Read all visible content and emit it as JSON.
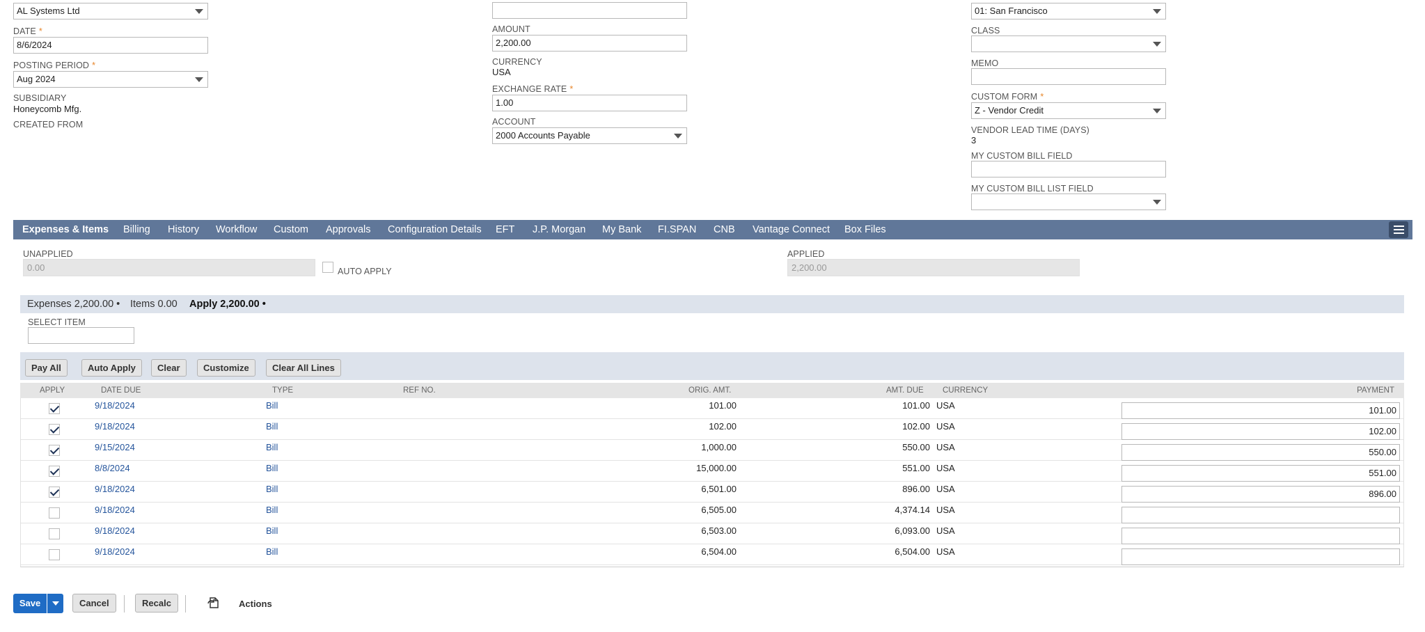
{
  "colors": {
    "tabbar": "#607799",
    "accent": "#1f6cc5",
    "link": "#25559c",
    "required": "#e8862a"
  },
  "left": {
    "vendor_value": "AL Systems Ltd",
    "date_label": "DATE",
    "date_value": "8/6/2024",
    "posting_period_label": "POSTING PERIOD",
    "posting_period_value": "Aug 2024",
    "subsidiary_label": "SUBSIDIARY",
    "subsidiary_value": "Honeycomb Mfg.",
    "created_from_label": "CREATED FROM",
    "required_mark": "*"
  },
  "middle": {
    "top_field_value": "",
    "amount_label": "AMOUNT",
    "amount_value": "2,200.00",
    "currency_label": "CURRENCY",
    "currency_value": "USA",
    "exchange_rate_label": "EXCHANGE RATE",
    "exchange_rate_value": "1.00",
    "account_label": "ACCOUNT",
    "account_value": "2000 Accounts Payable"
  },
  "right": {
    "location_value": "01: San Francisco",
    "class_label": "CLASS",
    "class_value": "",
    "memo_label": "MEMO",
    "memo_value": "",
    "custom_form_label": "CUSTOM FORM",
    "custom_form_value": "Z - Vendor Credit",
    "lead_time_label": "VENDOR LEAD TIME (DAYS)",
    "lead_time_value": "3",
    "custom_bill_field_label": "MY CUSTOM BILL FIELD",
    "custom_bill_field_value": "",
    "custom_bill_list_label": "MY CUSTOM BILL LIST FIELD",
    "custom_bill_list_value": ""
  },
  "tabs": [
    "Expenses & Items",
    "Billing",
    "History",
    "Workflow",
    "Custom",
    "Approvals",
    "Configuration Details",
    "EFT",
    "J.P. Morgan",
    "My Bank",
    "FI.SPAN",
    "CNB",
    "Vantage Connect",
    "Box Files"
  ],
  "apply_section": {
    "unapplied_label": "UNAPPLIED",
    "unapplied_value": "0.00",
    "auto_apply_label": "AUTO APPLY",
    "applied_label": "APPLIED",
    "applied_value": "2,200.00"
  },
  "subtabs": [
    "Expenses 2,200.00 •",
    "Items 0.00",
    "Apply 2,200.00 •"
  ],
  "select_item_label": "SELECT ITEM",
  "select_item_value": "",
  "buttons": [
    "Pay All",
    "Auto Apply",
    "Clear",
    "Customize",
    "Clear All Lines"
  ],
  "columns": {
    "apply": "APPLY",
    "date_due": "DATE DUE",
    "type": "TYPE",
    "ref_no": "REF NO.",
    "orig_amt": "ORIG. AMT.",
    "amt_due": "AMT. DUE",
    "currency": "CURRENCY",
    "payment": "PAYMENT"
  },
  "rows": [
    {
      "checked": true,
      "date_due": "9/18/2024",
      "type": "Bill",
      "ref_no": "",
      "orig_amt": "101.00",
      "amt_due": "101.00",
      "currency": "USA",
      "payment": "101.00"
    },
    {
      "checked": true,
      "date_due": "9/18/2024",
      "type": "Bill",
      "ref_no": "",
      "orig_amt": "102.00",
      "amt_due": "102.00",
      "currency": "USA",
      "payment": "102.00"
    },
    {
      "checked": true,
      "date_due": "9/15/2024",
      "type": "Bill",
      "ref_no": "",
      "orig_amt": "1,000.00",
      "amt_due": "550.00",
      "currency": "USA",
      "payment": "550.00"
    },
    {
      "checked": true,
      "date_due": "8/8/2024",
      "type": "Bill",
      "ref_no": "",
      "orig_amt": "15,000.00",
      "amt_due": "551.00",
      "currency": "USA",
      "payment": "551.00"
    },
    {
      "checked": true,
      "date_due": "9/18/2024",
      "type": "Bill",
      "ref_no": "",
      "orig_amt": "6,501.00",
      "amt_due": "896.00",
      "currency": "USA",
      "payment": "896.00"
    },
    {
      "checked": false,
      "date_due": "9/18/2024",
      "type": "Bill",
      "ref_no": "",
      "orig_amt": "6,505.00",
      "amt_due": "4,374.14",
      "currency": "USA",
      "payment": ""
    },
    {
      "checked": false,
      "date_due": "9/18/2024",
      "type": "Bill",
      "ref_no": "",
      "orig_amt": "6,503.00",
      "amt_due": "6,093.00",
      "currency": "USA",
      "payment": ""
    },
    {
      "checked": false,
      "date_due": "9/18/2024",
      "type": "Bill",
      "ref_no": "",
      "orig_amt": "6,504.00",
      "amt_due": "6,504.00",
      "currency": "USA",
      "payment": ""
    }
  ],
  "footer": {
    "save": "Save",
    "cancel": "Cancel",
    "recalc": "Recalc",
    "actions": "Actions"
  }
}
